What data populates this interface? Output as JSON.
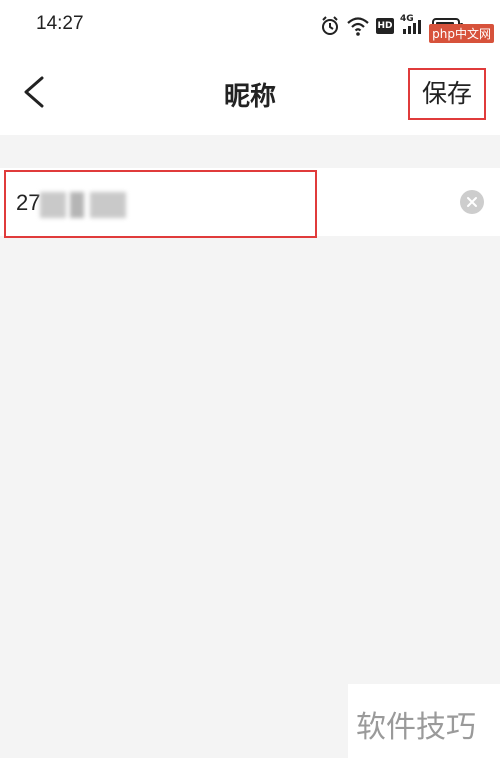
{
  "status_bar": {
    "time": "14:27",
    "icons": [
      "alarm-icon",
      "wifi-icon",
      "hd-icon",
      "signal-4g-icon",
      "battery-icon"
    ],
    "network_label": "4G",
    "hd_label": "HD"
  },
  "watermark": {
    "top_badge": "php中文网",
    "bottom_text": "软件技巧"
  },
  "nav": {
    "back_icon": "chevron-left-icon",
    "title": "昵称",
    "save_label": "保存"
  },
  "nickname_input": {
    "value_visible_prefix": "27",
    "value_obscured": true,
    "clear_icon": "clear-circle-icon"
  },
  "colors": {
    "highlight_border": "#e03b3b",
    "background": "#f4f4f4",
    "surface": "#ffffff"
  }
}
